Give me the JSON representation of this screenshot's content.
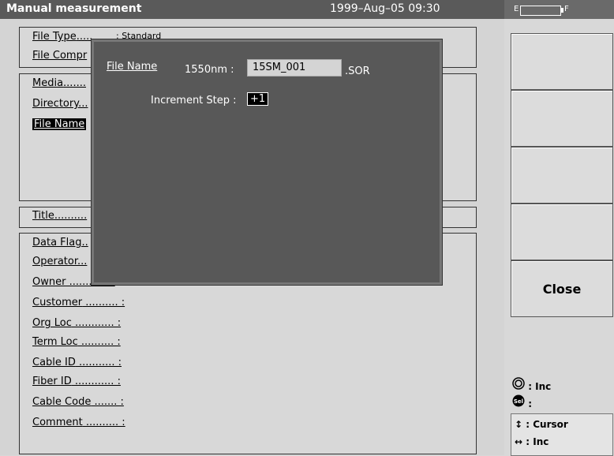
{
  "title": "Manual measurement",
  "datetime": "1999–Aug–05 09:30",
  "battery": {
    "e": "E",
    "f": "F"
  },
  "fields": {
    "file_type": "File Type",
    "file_type_value": ": Standard",
    "file_compr": "File Compr",
    "media": "Media",
    "directory": "Directory",
    "file_name": "File Name",
    "title": "Title",
    "data_flag": "Data Flag",
    "operator": "Operator",
    "owner": "Owner",
    "customer": "Customer",
    "org_loc": "Org Loc",
    "term_loc": "Term Loc",
    "cable_id": "Cable ID",
    "fiber_id": "Fiber ID",
    "cable_code": "Cable Code",
    "comment": "Comment"
  },
  "dialog": {
    "file_name_label": "File Name",
    "wavelength_label": "1550nm :",
    "file_name_value": "15SM_001",
    "extension": ".SOR",
    "increment_label": "Increment Step :",
    "increment_value": "+1"
  },
  "right": {
    "close_label": "Close",
    "legend_inc": ": Inc",
    "legend_sel": ":",
    "sel_icon": "Sel",
    "cursor": ": Cursor",
    "inc": ": Inc"
  }
}
